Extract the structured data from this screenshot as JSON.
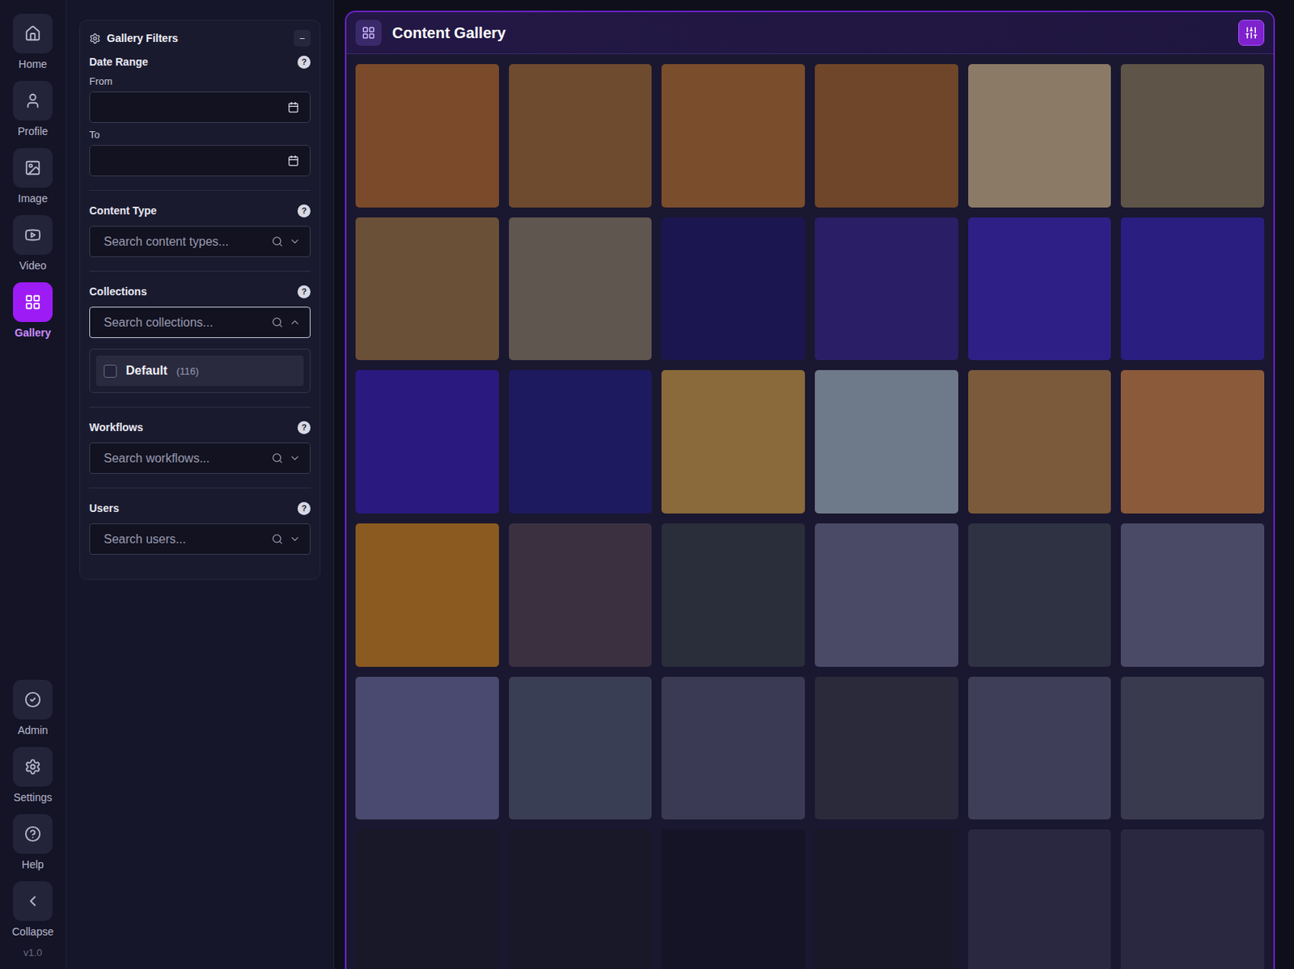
{
  "nav": {
    "items": [
      {
        "label": "Home",
        "selected": false
      },
      {
        "label": "Profile",
        "selected": false
      },
      {
        "label": "Image",
        "selected": false
      },
      {
        "label": "Video",
        "selected": false
      },
      {
        "label": "Gallery",
        "selected": true
      }
    ],
    "bottom": [
      {
        "label": "Admin"
      },
      {
        "label": "Settings"
      },
      {
        "label": "Help"
      },
      {
        "label": "Collapse"
      }
    ],
    "version": "v1.0"
  },
  "filters": {
    "title": "Gallery Filters",
    "collapse": "−",
    "date_range": {
      "label": "Date Range",
      "help": "?",
      "from": {
        "label": "From"
      },
      "to": {
        "label": "To"
      }
    },
    "sections": [
      {
        "label": "Content Type",
        "help": "?",
        "placeholder": "Search content types...",
        "expanded": false,
        "focused": false,
        "options": []
      },
      {
        "label": "Collections",
        "help": "?",
        "placeholder": "Search collections...",
        "expanded": true,
        "focused": true,
        "options": [
          {
            "label": "Default",
            "count": "(116)",
            "checked": false
          }
        ]
      },
      {
        "label": "Workflows",
        "help": "?",
        "placeholder": "Search workflows...",
        "expanded": false,
        "focused": false,
        "options": []
      },
      {
        "label": "Users",
        "help": "?",
        "placeholder": "Search users...",
        "expanded": false,
        "focused": false,
        "options": []
      }
    ]
  },
  "gallery": {
    "title": "Content Gallery",
    "tiles": [
      {
        "color": "#7a4a2a"
      },
      {
        "color": "#6e4a2e"
      },
      {
        "color": "#7a4d2c"
      },
      {
        "color": "#6f4629"
      },
      {
        "color": "#8a7a66"
      },
      {
        "color": "#5e5447"
      },
      {
        "color": "#6b5038"
      },
      {
        "color": "#5f5650"
      },
      {
        "color": "#1c1650"
      },
      {
        "color": "#2a1f66"
      },
      {
        "color": "#2e1f86"
      },
      {
        "color": "#2a1e80"
      },
      {
        "color": "#2a1a80"
      },
      {
        "color": "#1e1a60"
      },
      {
        "color": "#8a6a3a"
      },
      {
        "color": "#6e7a8a"
      },
      {
        "color": "#7a5a3a"
      },
      {
        "color": "#8a5a3a"
      },
      {
        "color": "#8a5a20"
      },
      {
        "color": "#3a3040"
      },
      {
        "color": "#2a2d3a"
      },
      {
        "color": "#4a4a66"
      },
      {
        "color": "#2e3242"
      },
      {
        "color": "#4a4a66"
      },
      {
        "color": "#4a4a70"
      },
      {
        "color": "#3a3e55"
      },
      {
        "color": "#3a3a55"
      },
      {
        "color": "#2a2a3a"
      },
      {
        "color": "#3e3e58"
      },
      {
        "color": "#3a3a4e"
      },
      {
        "color": "#181828"
      },
      {
        "color": "#181828"
      },
      {
        "color": "#141426"
      },
      {
        "color": "#181828"
      },
      {
        "color": "#2a2840"
      },
      {
        "color": "#2a2840"
      }
    ]
  }
}
